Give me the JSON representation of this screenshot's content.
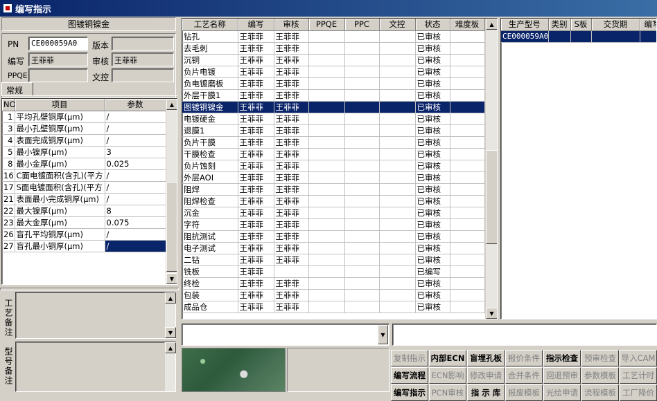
{
  "window": {
    "title": "编写指示"
  },
  "left": {
    "header": "图镀铜镍金",
    "pn_label": "PN",
    "pn_value": "CE000059A0",
    "version_label": "版本",
    "version_value": "",
    "writer_label": "编写",
    "writer_value": "王菲菲",
    "review_label": "审核",
    "review_value": "王菲菲",
    "ppqe_label": "PPQE",
    "ppqe_value": "",
    "doc_label": "文控",
    "doc_value": "",
    "tab": "常规",
    "param_headers": [
      "NO",
      "项目",
      "参数"
    ],
    "params": [
      {
        "no": "1",
        "item": "平均孔壁铜厚(μm)",
        "value": "/"
      },
      {
        "no": "3",
        "item": "最小孔壁铜厚(μm)",
        "value": "/"
      },
      {
        "no": "4",
        "item": "表面完成铜厚(μm)",
        "value": "/"
      },
      {
        "no": "5",
        "item": "最小镍厚(μm)",
        "value": "3"
      },
      {
        "no": "8",
        "item": "最小金厚(μm)",
        "value": "0.025"
      },
      {
        "no": "16",
        "item": "C面电镀面积(含孔)(平方",
        "value": "/"
      },
      {
        "no": "17",
        "item": "S面电镀面积(含孔)(平方",
        "value": "/"
      },
      {
        "no": "21",
        "item": "表面最小完成铜厚(μm)",
        "value": "/"
      },
      {
        "no": "22",
        "item": "最大镍厚(μm)",
        "value": "8"
      },
      {
        "no": "23",
        "item": "最大金厚(μm)",
        "value": "0.075"
      },
      {
        "no": "26",
        "item": "盲孔平均铜厚(μm)",
        "value": "/"
      },
      {
        "no": "27",
        "item": "盲孔最小铜厚(μm)",
        "value": "/"
      }
    ],
    "process_note_label": "工艺备注",
    "model_note_label": "型号备注"
  },
  "middle": {
    "headers": [
      "工艺名称",
      "编写",
      "审核",
      "PPQE",
      "PPC",
      "文控",
      "状态",
      "难度板"
    ],
    "rows": [
      [
        "钻孔",
        "王菲菲",
        "王菲菲",
        "",
        "",
        "",
        "已审核",
        ""
      ],
      [
        "去毛刺",
        "王菲菲",
        "王菲菲",
        "",
        "",
        "",
        "已审核",
        ""
      ],
      [
        "沉铜",
        "王菲菲",
        "王菲菲",
        "",
        "",
        "",
        "已审核",
        ""
      ],
      [
        "负片电镀",
        "王菲菲",
        "王菲菲",
        "",
        "",
        "",
        "已审核",
        ""
      ],
      [
        "负电镀磨板",
        "王菲菲",
        "王菲菲",
        "",
        "",
        "",
        "已审核",
        ""
      ],
      [
        "外层干膜1",
        "王菲菲",
        "王菲菲",
        "",
        "",
        "",
        "已审核",
        ""
      ],
      [
        "图镀铜镍金",
        "王菲菲",
        "王菲菲",
        "",
        "",
        "",
        "已审核",
        ""
      ],
      [
        "电镀硬金",
        "王菲菲",
        "王菲菲",
        "",
        "",
        "",
        "已审核",
        ""
      ],
      [
        "退膜1",
        "王菲菲",
        "王菲菲",
        "",
        "",
        "",
        "已审核",
        ""
      ],
      [
        "负片干膜",
        "王菲菲",
        "王菲菲",
        "",
        "",
        "",
        "已审核",
        ""
      ],
      [
        "干膜检查",
        "王菲菲",
        "王菲菲",
        "",
        "",
        "",
        "已审核",
        ""
      ],
      [
        "负片蚀刻",
        "王菲菲",
        "王菲菲",
        "",
        "",
        "",
        "已审核",
        ""
      ],
      [
        "外层AOI",
        "王菲菲",
        "王菲菲",
        "",
        "",
        "",
        "已审核",
        ""
      ],
      [
        "阻焊",
        "王菲菲",
        "王菲菲",
        "",
        "",
        "",
        "已审核",
        ""
      ],
      [
        "阻焊检查",
        "王菲菲",
        "王菲菲",
        "",
        "",
        "",
        "已审核",
        ""
      ],
      [
        "沉金",
        "王菲菲",
        "王菲菲",
        "",
        "",
        "",
        "已审核",
        ""
      ],
      [
        "字符",
        "王菲菲",
        "王菲菲",
        "",
        "",
        "",
        "已审核",
        ""
      ],
      [
        "阻抗测试",
        "王菲菲",
        "王菲菲",
        "",
        "",
        "",
        "已审核",
        ""
      ],
      [
        "电子测试",
        "王菲菲",
        "王菲菲",
        "",
        "",
        "",
        "已审核",
        ""
      ],
      [
        "二钻",
        "王菲菲",
        "王菲菲",
        "",
        "",
        "",
        "已审核",
        ""
      ],
      [
        "铣板",
        "王菲菲",
        "",
        "",
        "",
        "",
        "已编写",
        ""
      ],
      [
        "终检",
        "王菲菲",
        "王菲菲",
        "",
        "",
        "",
        "已审核",
        ""
      ],
      [
        "包装",
        "王菲菲",
        "王菲菲",
        "",
        "",
        "",
        "已审核",
        ""
      ],
      [
        "成品仓",
        "王菲菲",
        "王菲菲",
        "",
        "",
        "",
        "已审核",
        ""
      ]
    ],
    "selected_row": 6
  },
  "right": {
    "headers": [
      "生产型号",
      "类别",
      "S板",
      "交货期",
      "编写"
    ],
    "rows": [
      [
        "CE000059A0",
        "",
        "",
        "",
        ""
      ]
    ]
  },
  "buttons": {
    "row1": [
      "复制指示",
      "内部ECN",
      "盲埋孔板",
      "报价条件",
      "指示检查",
      "预审检查",
      "导入CAM"
    ],
    "row2": [
      "编写流程",
      "ECN影响",
      "修改申请",
      "合并条件",
      "回退预审",
      "参数模板",
      "工艺计时"
    ],
    "row3": [
      "编写指示",
      "PCN审核",
      "指 示 库",
      "报废模板",
      "光绘申请",
      "流程模板",
      "工厂降价"
    ]
  },
  "colors": {
    "selection": "#0a246a",
    "face": "#d4d0c8",
    "title_start": "#0a246a",
    "title_end": "#3a6ea5"
  }
}
